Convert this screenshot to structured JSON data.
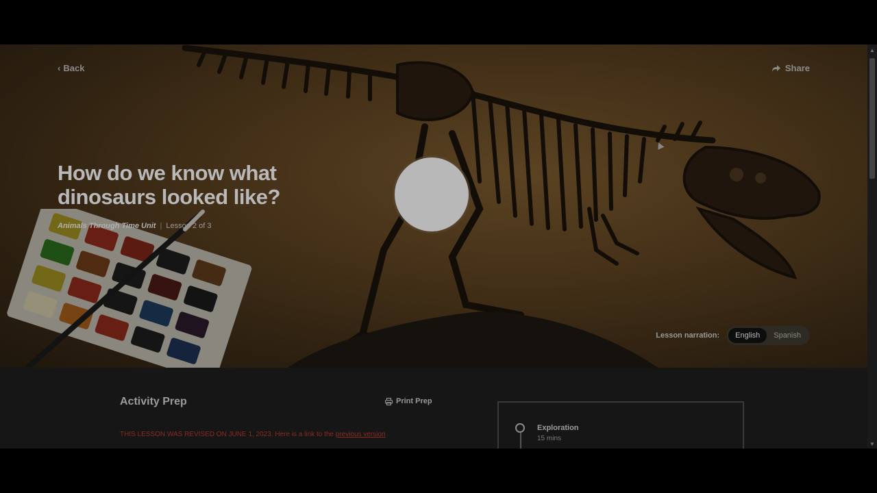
{
  "nav": {
    "back_label": "Back",
    "share_label": "Share"
  },
  "hero": {
    "title": "How do we know what dinosaurs looked like?",
    "unit": "Animals Through Time Unit",
    "separator": "|",
    "lesson": "Lesson 2 of 3",
    "narration_label": "Lesson narration:",
    "languages": [
      "English",
      "Spanish"
    ],
    "selected_language": "English"
  },
  "prep": {
    "title": "Activity Prep",
    "print_label": "Print Prep",
    "revision_text": "THIS LESSON WAS REVISED ON JUNE 1, 2023. Here is a link to the ",
    "revision_link": "previous version"
  },
  "timeline": {
    "steps": [
      {
        "name": "Exploration",
        "duration": "15 mins"
      }
    ]
  },
  "icons": {
    "back": "chevron-left-icon",
    "share": "share-arrow-icon",
    "print": "printer-icon",
    "play": "play-icon"
  },
  "colors": {
    "revision_text": "#8c2a22",
    "hero_bg": "#5a4020"
  }
}
